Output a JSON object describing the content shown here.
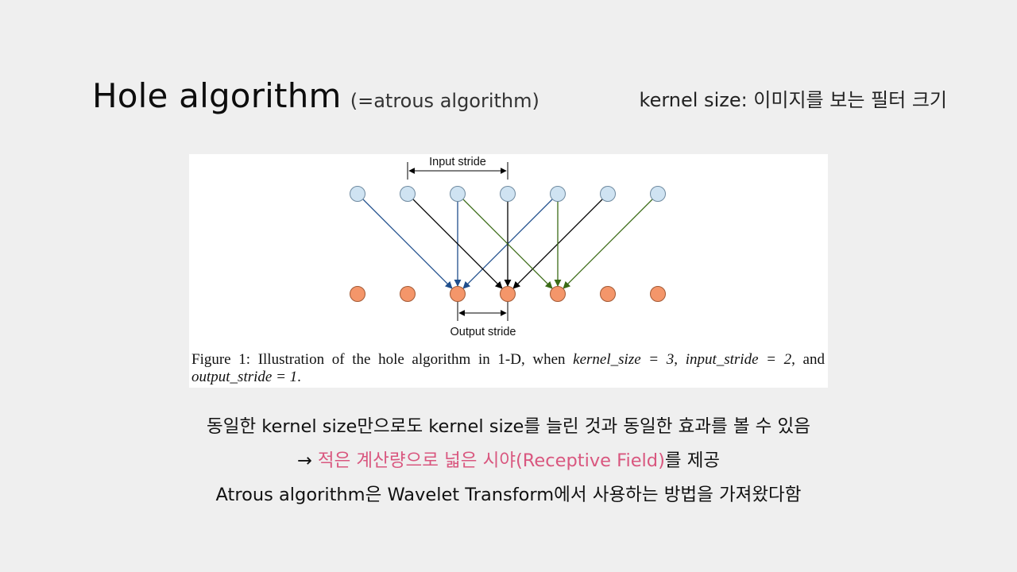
{
  "slide": {
    "title": "Hole algorithm",
    "title_sub": "(=atrous algorithm)",
    "side_note": "kernel size: 이미지를 보는 필터 크기"
  },
  "figure": {
    "input_stride_label": "Input stride",
    "output_stride_label": "Output stride",
    "caption": {
      "prefix": "Figure 1:  Illustration of the hole algorithm in 1-D, when ",
      "kernel_size": "kernel_size = 3",
      "sep1": ", ",
      "input_stride": "input_stride = 2",
      "sep2": ", and",
      "output_stride": "output_stride = 1",
      "end": "."
    },
    "colors": {
      "input_node": "#cfe3f2",
      "output_node": "#f4966a",
      "arrow_blue": "#1f4e8c",
      "arrow_black": "#000000",
      "arrow_green": "#3b6b16"
    }
  },
  "bullets": {
    "line1": "동일한 kernel size만으로도 kernel size를 늘린 것과 동일한 효과를 볼 수 있음",
    "line2_arrow": "→ ",
    "line2_highlight": "적은 계산량으로 넓은 시야(Receptive Field)",
    "line2_rest": "를 제공",
    "line3": "Atrous algorithm은 Wavelet Transform에서 사용하는 방법을 가져왔다함",
    "highlight_color": "#d9577f"
  }
}
